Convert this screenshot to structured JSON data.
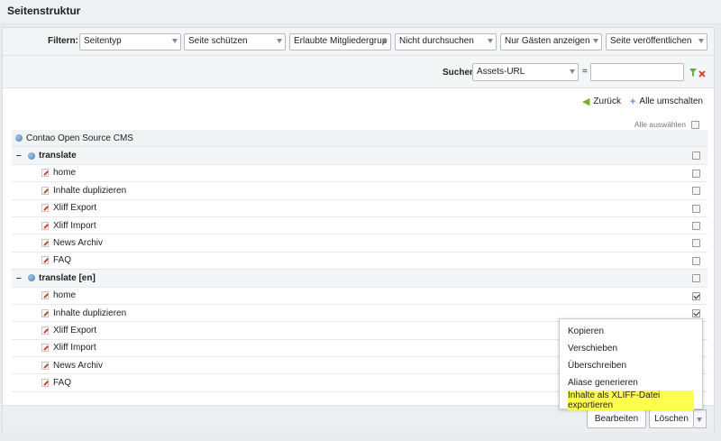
{
  "header": {
    "title": "Seitenstruktur"
  },
  "filters": {
    "label": "Filtern:",
    "selects": [
      {
        "value": "Seitentyp"
      },
      {
        "value": "Seite schützen"
      },
      {
        "value": "Erlaubte Mitgliedergrup"
      },
      {
        "value": "Nicht durchsuchen"
      },
      {
        "value": "Nur Gästen anzeigen"
      },
      {
        "value": "Seite veröffentlichen"
      }
    ]
  },
  "search": {
    "label": "Suchen:",
    "field": "Assets-URL",
    "operator": "=",
    "value": ""
  },
  "nav": {
    "back": "Zurück",
    "toggle_all": "Alle umschalten"
  },
  "select_all": "Alle auswählen",
  "tree": {
    "root": "Contao Open Source CMS",
    "groups": [
      {
        "label": "translate",
        "toggle": "–",
        "pages": [
          {
            "label": "home",
            "checked": false
          },
          {
            "label": "Inhalte duplizieren",
            "checked": false
          },
          {
            "label": "Xliff Export",
            "checked": false
          },
          {
            "label": "Xliff Import",
            "checked": false
          },
          {
            "label": "News Archiv",
            "checked": false
          },
          {
            "label": "FAQ",
            "checked": false
          }
        ]
      },
      {
        "label": "translate [en]",
        "toggle": "–",
        "pages": [
          {
            "label": "home",
            "checked": true
          },
          {
            "label": "Inhalte duplizieren",
            "checked": true
          },
          {
            "label": "Xliff Export",
            "checked": false
          },
          {
            "label": "Xliff Import",
            "checked": false
          },
          {
            "label": "News Archiv",
            "checked": false
          },
          {
            "label": "FAQ",
            "checked": false
          }
        ]
      }
    ]
  },
  "footer": {
    "edit": "Bearbeiten",
    "delete": "Löschen"
  },
  "menu": {
    "items": [
      "Kopieren",
      "Verschieben",
      "Überschreiben",
      "Aliase generieren",
      "Inhalte als XLIFF-Datei exportieren"
    ],
    "highlighted_index": 4,
    "highlight_color": "#ffff4d"
  }
}
